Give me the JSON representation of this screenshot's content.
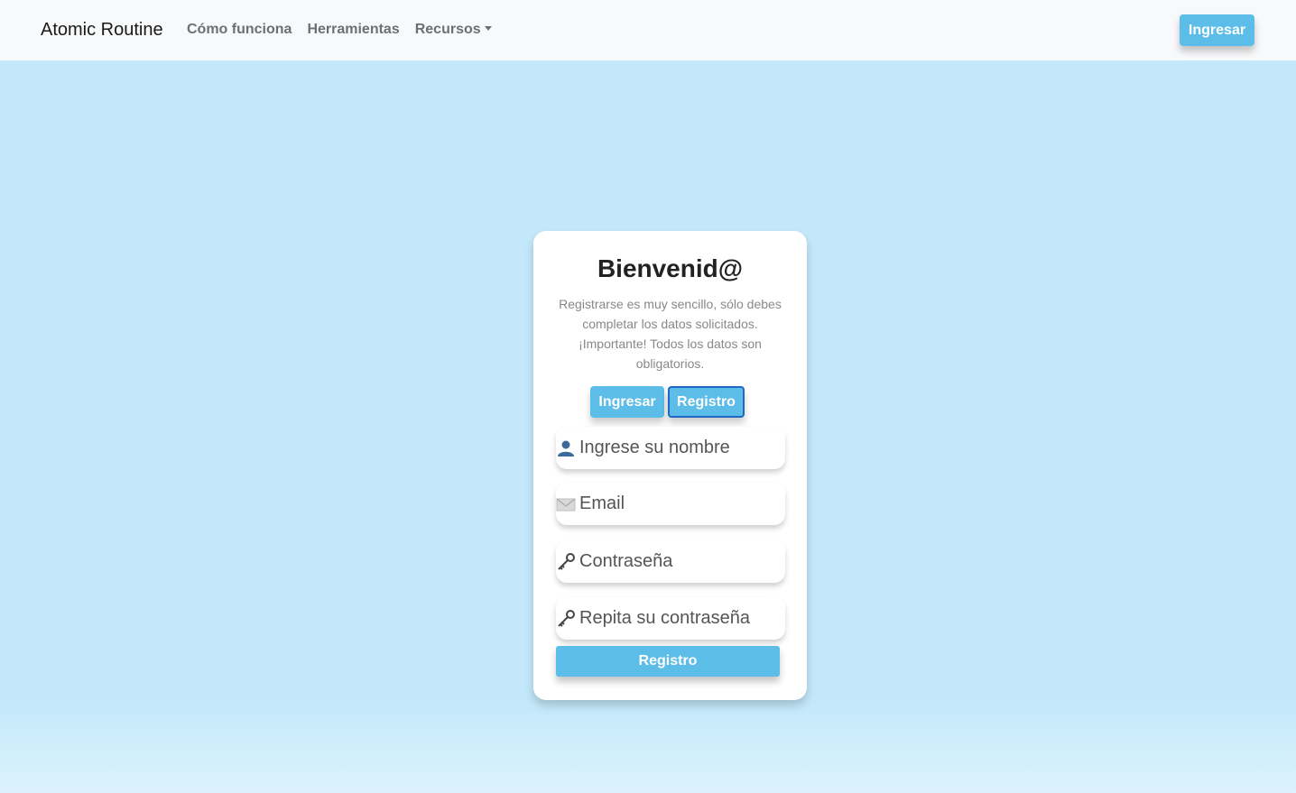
{
  "navbar": {
    "brand": "Atomic Routine",
    "links": [
      "Cómo funciona",
      "Herramientas",
      "Recursos"
    ],
    "login_button": "Ingresar"
  },
  "card": {
    "title": "Bienvenid@",
    "description": "Registrarse es muy sencillo, sólo debes completar los datos solicitados. ¡Importante! Todos los datos son obligatorios.",
    "tabs": {
      "login": "Ingresar",
      "register": "Registro"
    },
    "fields": {
      "name": {
        "placeholder": "Ingrese su nombre",
        "icon": "user-icon"
      },
      "email": {
        "placeholder": "Email",
        "icon": "envelope-icon"
      },
      "password": {
        "placeholder": "Contraseña",
        "icon": "key-icon"
      },
      "password_repeat": {
        "placeholder": "Repita su contraseña",
        "icon": "key-icon"
      }
    },
    "submit": "Registro"
  },
  "colors": {
    "accent": "#5bbde8",
    "background": "#c2e8fa",
    "active_border": "#1d69c4"
  }
}
